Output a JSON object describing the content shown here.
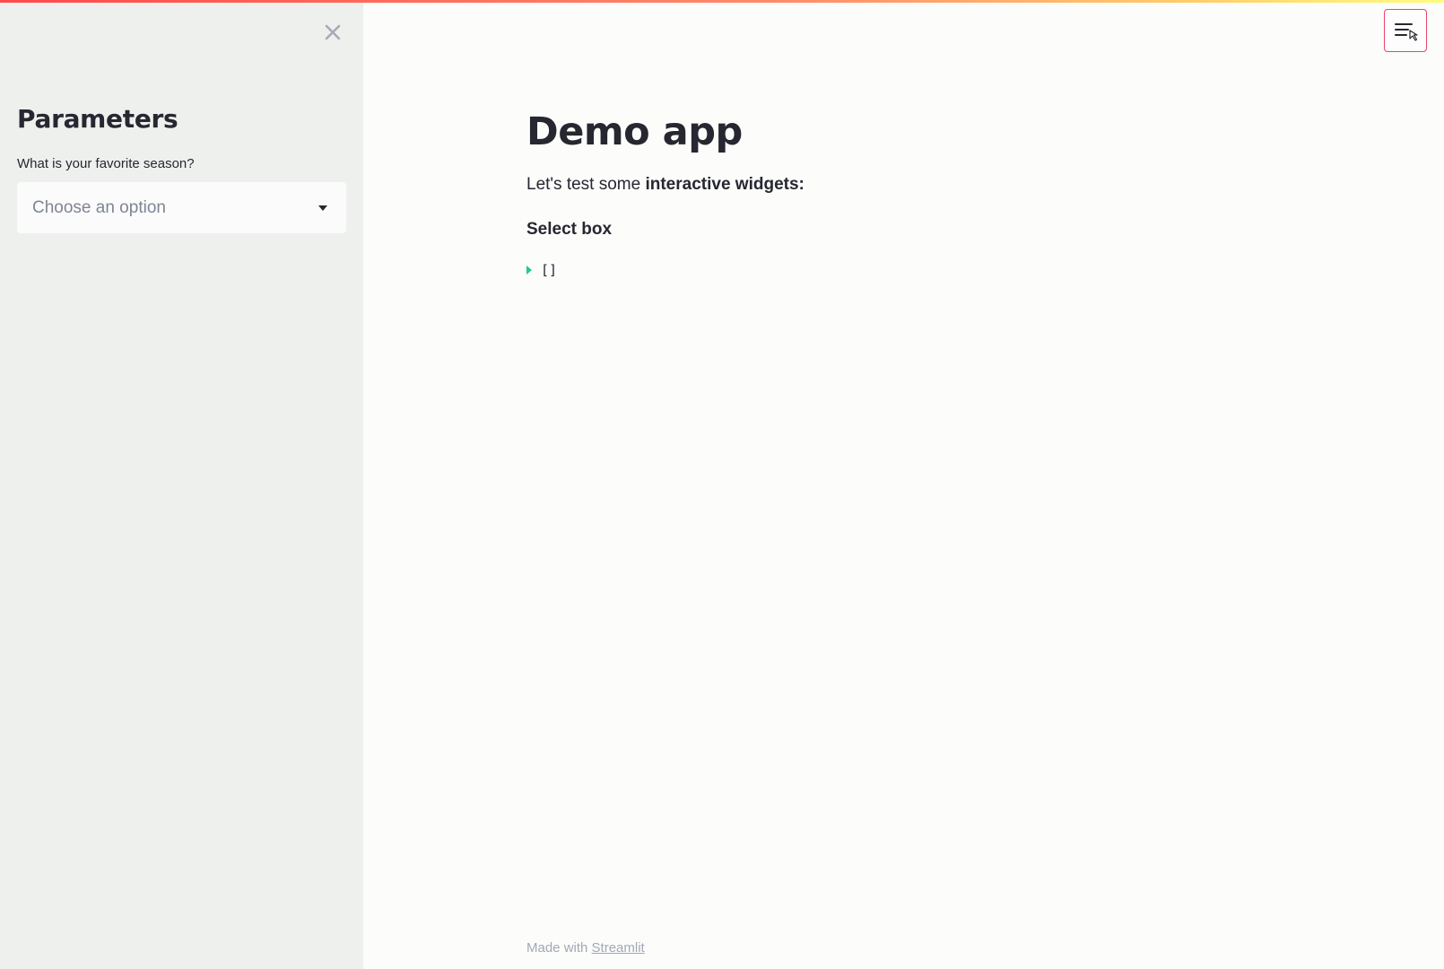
{
  "sidebar": {
    "close_icon": "close-icon",
    "title": "Parameters",
    "season_select": {
      "label": "What is your favorite season?",
      "placeholder": "Choose an option",
      "caret_icon": "caret-down-icon"
    }
  },
  "main": {
    "title": "Demo app",
    "intro_prefix": "Let's test some ",
    "intro_bold": "interactive widgets:",
    "section_heading": "Select box",
    "json_output": "[]"
  },
  "header": {
    "menu_icon": "hamburger-menu-icon"
  },
  "footer": {
    "prefix": "Made with ",
    "link": "Streamlit"
  },
  "colors": {
    "accent": "#ff4b4b",
    "menu_border": "#e8456b",
    "json_toggle": "#20c997"
  }
}
